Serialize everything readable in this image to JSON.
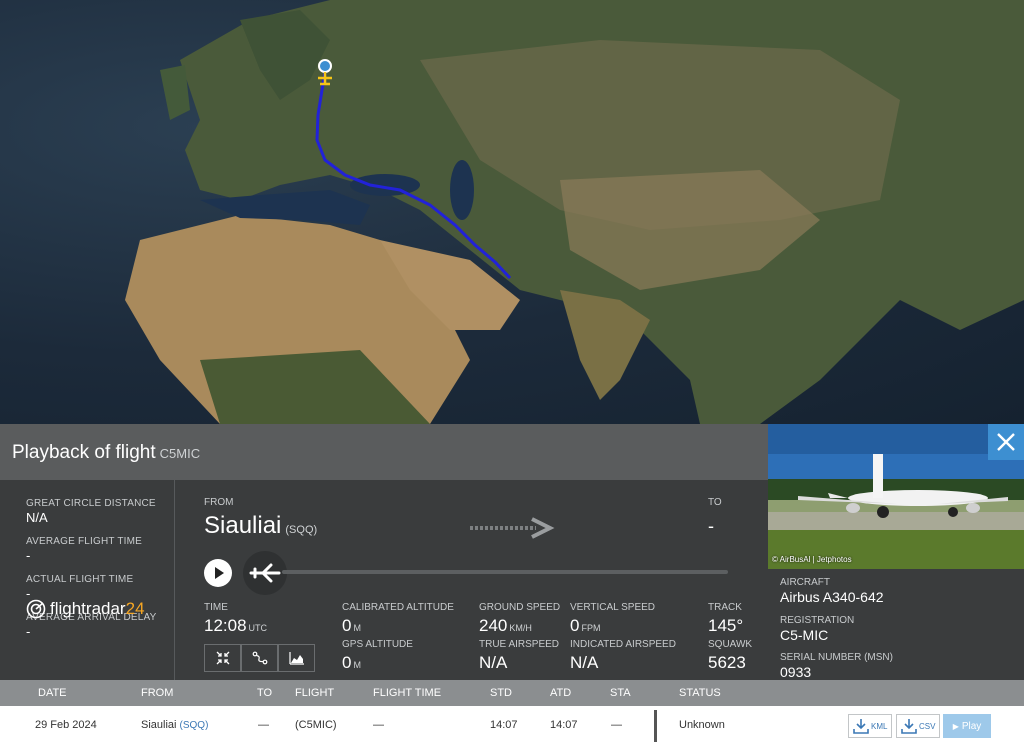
{
  "panel": {
    "title": "Playback of flight",
    "registration": "C5MIC",
    "left": [
      {
        "label": "GREAT CIRCLE DISTANCE",
        "value": "N/A"
      },
      {
        "label": "AVERAGE FLIGHT TIME",
        "value": "-"
      },
      {
        "label": "ACTUAL FLIGHT TIME",
        "value": "-"
      },
      {
        "label": "AVERAGE ARRIVAL DELAY",
        "value": "-"
      }
    ],
    "logo_text_pre": "flightradar",
    "logo_text_num": "24",
    "from_label": "FROM",
    "from_city": "Siauliai",
    "from_code": "(SQQ)",
    "to_label": "TO",
    "to_value": "-",
    "time": {
      "label": "TIME",
      "value": "12:08",
      "unit": "UTC"
    },
    "cal_alt": {
      "label": "CALIBRATED ALTITUDE",
      "value": "0",
      "unit": "M"
    },
    "gps_alt": {
      "label": "GPS ALTITUDE",
      "value": "0",
      "unit": "M"
    },
    "ground_speed": {
      "label": "GROUND SPEED",
      "value": "240",
      "unit": "KM/H"
    },
    "true_airspeed": {
      "label": "TRUE AIRSPEED",
      "value": "N/A"
    },
    "vertical_speed": {
      "label": "VERTICAL SPEED",
      "value": "0",
      "unit": "FPM"
    },
    "indicated_airspeed": {
      "label": "INDICATED AIRSPEED",
      "value": "N/A"
    },
    "track": {
      "label": "TRACK",
      "value": "145°"
    },
    "squawk": {
      "label": "SQUAWK",
      "value": "5623"
    }
  },
  "aircraft": {
    "photo_credit": "© AirBusAl | Jetphotos",
    "type_label": "AIRCRAFT",
    "type_value": "Airbus A340-642",
    "reg_label": "REGISTRATION",
    "reg_value": "C5-MIC",
    "serial_label": "SERIAL NUMBER (MSN)",
    "serial_value": "0933"
  },
  "table": {
    "headers": [
      "DATE",
      "FROM",
      "TO",
      "FLIGHT",
      "FLIGHT TIME",
      "STD",
      "ATD",
      "STA",
      "STATUS"
    ],
    "row": {
      "date": "29 Feb 2024",
      "from": "Siauliai",
      "from_code": "(SQQ)",
      "to": "—",
      "flight": "(C5MIC)",
      "flight_time": "—",
      "std": "14:07",
      "atd": "14:07",
      "sta": "—",
      "status": "Unknown"
    },
    "kml_label": "KML",
    "csv_label": "CSV",
    "play_label": "Play"
  },
  "colors": {
    "route": "#2222d8",
    "accent": "#3d8fd1",
    "logo_accent": "#f5a623"
  }
}
